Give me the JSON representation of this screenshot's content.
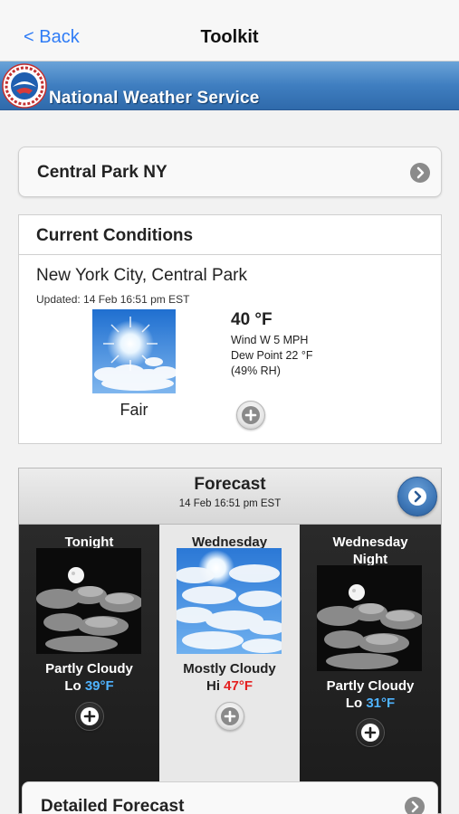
{
  "navbar": {
    "back_label": "< Back",
    "title": "Toolkit"
  },
  "banner": {
    "name": "National Weather Service",
    "logo_text": "NATIONAL WEATHER SERVICE"
  },
  "location": {
    "label": "Central Park NY"
  },
  "current": {
    "header": "Current Conditions",
    "station": "New York City, Central Park",
    "updated": "Updated: 14 Feb 16:51 pm EST",
    "description": "Fair",
    "temperature": "40 °F",
    "wind": "Wind W 5 MPH",
    "dewpoint": "Dew Point 22 °F",
    "humidity": "(49% RH)"
  },
  "forecast": {
    "header": "Forecast",
    "date": "14 Feb 16:51 pm EST",
    "periods": [
      {
        "name": "Tonight",
        "condition": "Partly Cloudy",
        "temp_prefix": "Lo",
        "temp": "39°F",
        "icon": "partly-cloudy-night-icon"
      },
      {
        "name": "Wednesday",
        "condition": "Mostly Cloudy",
        "temp_prefix": "Hi",
        "temp": "47°F",
        "icon": "mostly-cloudy-day-icon"
      },
      {
        "name": "Wednesday Night",
        "condition": "Partly Cloudy",
        "temp_prefix": "Lo",
        "temp": "31°F",
        "icon": "partly-cloudy-night-icon"
      }
    ]
  },
  "detailed": {
    "label": "Detailed Forecast"
  },
  "colors": {
    "accent": "#2f7cf6",
    "banner": "#3f7ec0",
    "lo_temp": "#4fb3ff",
    "hi_temp": "#e52020"
  }
}
